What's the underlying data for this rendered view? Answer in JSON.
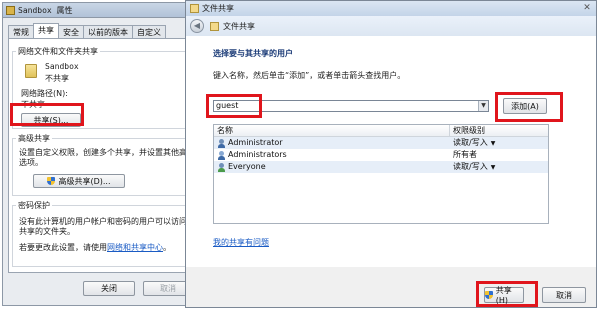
{
  "props_dialog": {
    "title": "Sandbox 属性",
    "tabs": [
      "常规",
      "共享",
      "安全",
      "以前的版本",
      "自定义"
    ],
    "active_tab": 1,
    "net_share_group": {
      "legend": "网络文件和文件夹共享",
      "folder_name": "Sandbox",
      "folder_status": "不共享",
      "path_label": "网络路径(N):",
      "path_value": "不共享",
      "share_button": "共享(S)..."
    },
    "advanced_group": {
      "legend": "高级共享",
      "desc_line1": "设置自定义权限，创建多个共享，并设置其他高",
      "desc_line2": "选项。",
      "button": "高级共享(D)..."
    },
    "password_group": {
      "legend": "密码保护",
      "desc_line1": "没有此计算机的用户帐户和密码的用户可以访问",
      "desc_line2": "共享的文件夹。",
      "change_prefix": "若要更改此设置，请使用",
      "change_link": "网络和共享中心",
      "change_suffix": "。"
    },
    "footer": {
      "close": "关闭",
      "cancel": "取消"
    }
  },
  "share_dialog": {
    "title": "文件共享",
    "close_glyph": "✕",
    "nav_title": "文件共享",
    "heading": "选择要与其共享的用户",
    "instruction": "键入名称，然后单击“添加”，或者单击箭头查找用户。",
    "input_value": "guest",
    "add_button": "添加(A)",
    "columns": [
      "名称",
      "权限级别"
    ],
    "rows": [
      {
        "name": "Administrator",
        "permission": "读取/写入",
        "has_dropdown": true,
        "icon": "user-icon"
      },
      {
        "name": "Administrators",
        "permission": "所有者",
        "has_dropdown": false,
        "icon": "group-icon"
      },
      {
        "name": "Everyone",
        "permission": "读取/写入",
        "has_dropdown": true,
        "icon": "everyone-icon"
      }
    ],
    "help_link": "我的共享有问题",
    "share_button": "共享(H)",
    "cancel_button": "取消"
  },
  "colors": {
    "highlight": "#e0151c",
    "link": "#1a5bc4",
    "heading": "#1c3c78"
  }
}
